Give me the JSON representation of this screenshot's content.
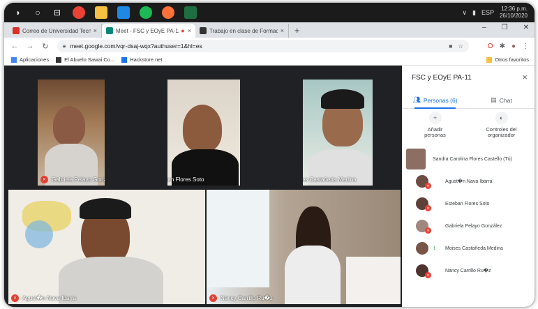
{
  "taskbar": {
    "apps": [
      {
        "name": "chrome-icon",
        "color": "#ea4335"
      },
      {
        "name": "file-explorer-icon",
        "color": "#f6c042"
      },
      {
        "name": "photos-icon",
        "color": "#1e88e5"
      },
      {
        "name": "spotify-icon",
        "color": "#1db954"
      },
      {
        "name": "firefox-icon",
        "color": "#ff7139"
      },
      {
        "name": "excel-icon",
        "color": "#1d6f42"
      }
    ],
    "lang": "ESP",
    "time": "12:36 p.m.",
    "date": "26/10/2020"
  },
  "tabs": [
    {
      "title": "Correo de Universidad Tecnológ",
      "favicon_color": "#d93025",
      "close": "×"
    },
    {
      "title": "Meet - FSC y EOyE PA-11",
      "favicon_color": "#00897b",
      "close": "×",
      "active": true
    },
    {
      "title": "Trabajo en clase de Formación c",
      "favicon_color": "#333333",
      "close": "×"
    }
  ],
  "new_tab": "+",
  "address": {
    "url": "meet.google.com/vqr-dsaj-wqx?authuser=1&hl=es"
  },
  "bookmarks": [
    {
      "label": "Aplicaciones",
      "color": "#4285f4"
    },
    {
      "label": "El Abuelo Sawai Co...",
      "color": "#333333"
    },
    {
      "label": "Hackstore.net",
      "color": "#1a73e8"
    }
  ],
  "bookmarks_other": "Otros favoritos",
  "videos": [
    {
      "name": "Gabriela Pelayo González",
      "status": "muted"
    },
    {
      "name": "Esteban Flores Soto",
      "status": "muted"
    },
    {
      "name": "Moises Castañeda Medina",
      "status": "talking"
    },
    {
      "name": "Agust�n Nava Ibarra",
      "status": "muted"
    },
    {
      "name": "Nancy Carrillo Ru�z",
      "status": "muted"
    }
  ],
  "panel": {
    "title": "FSC y EOyE PA-11",
    "close": "×",
    "tab_people": "Personas (6)",
    "tab_chat": "Chat",
    "add_people": "Añadir personas",
    "host_controls": "Controles del organizador",
    "participants": [
      {
        "name": "Sandra Carolina Flores Castello (Tú)",
        "status": "self",
        "color": "#8d6e63"
      },
      {
        "name": "Agust�n Nava Ibarra",
        "status": "muted",
        "color": "#6d4c41"
      },
      {
        "name": "Esteban Flores Soto",
        "status": "muted",
        "color": "#5d4037"
      },
      {
        "name": "Gabriela Pelayo González",
        "status": "muted",
        "color": "#a1887f"
      },
      {
        "name": "Moises Castañeda Medina",
        "status": "talking",
        "color": "#795548"
      },
      {
        "name": "Nancy Carrillo Ru�z",
        "status": "muted",
        "color": "#4e342e"
      }
    ]
  }
}
